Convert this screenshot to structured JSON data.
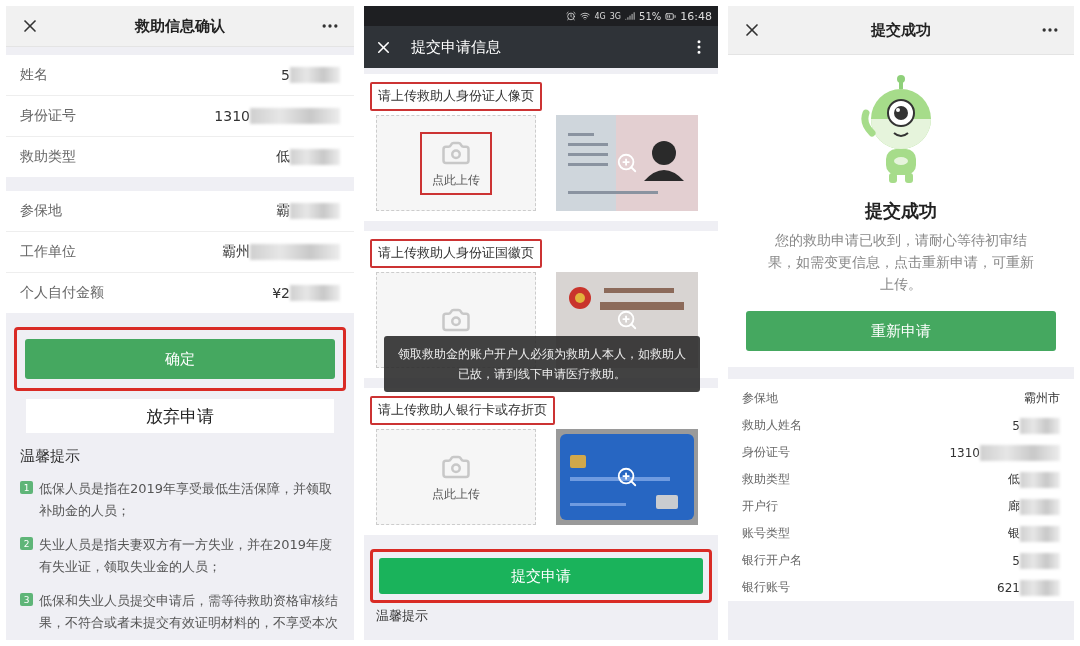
{
  "confirm_screen": {
    "title": "救助信息确认",
    "groups": [
      [
        {
          "label": "姓名",
          "value": "5",
          "redacted": true
        },
        {
          "label": "身份证号",
          "value": "1310",
          "redacted": true
        },
        {
          "label": "救助类型",
          "value": "低",
          "redacted": true
        }
      ],
      [
        {
          "label": "参保地",
          "value": "霸",
          "redacted": true
        },
        {
          "label": "工作单位",
          "value": "霸州",
          "redacted": true
        },
        {
          "label": "个人自付金额",
          "value": "¥2",
          "redacted": true
        }
      ]
    ],
    "confirm_button": {
      "label": "确定",
      "highlighted": true
    },
    "cancel_button": {
      "label": "放弃申请"
    },
    "tips_title": "温馨提示",
    "tips": [
      {
        "number": "1",
        "text": "低保人员是指在2019年享受最低生活保障，并领取补助金的人员；"
      },
      {
        "number": "2",
        "text": "失业人员是指夫妻双方有一方失业，并在2019年度有失业证，领取失业金的人员；"
      },
      {
        "number": "3",
        "text": "低保和失业人员提交申请后，需等待救助资格审核结果，不符合或者未提交有效证明材料的，不享受本次"
      }
    ]
  },
  "upload_screen": {
    "status_bar": {
      "network_1": "4G",
      "network_2": "3G",
      "battery": "51%",
      "time": "16:48"
    },
    "title": "提交申请信息",
    "sections": [
      {
        "label": "请上传救助人身份证人像页",
        "label_highlighted": true,
        "upload_text": "点此上传",
        "upload_highlighted": true,
        "kind": "id_portrait"
      },
      {
        "label": "请上传救助人身份证国徽页",
        "label_highlighted": true,
        "kind": "id_emblem"
      },
      {
        "label": "请上传救助人银行卡或存折页",
        "label_highlighted": true,
        "upload_text": "点此上传",
        "upload_highlighted": false,
        "kind": "bank_card"
      }
    ],
    "toast": "领取救助金的账户开户人必须为救助人本人，如救助人已故，请到线下申请医疗救助。",
    "submit_button": {
      "label": "提交申请",
      "highlighted": true
    },
    "tips_title": "温馨提示"
  },
  "success_screen": {
    "title": "提交成功",
    "heading": "提交成功",
    "message": "您的救助申请已收到，请耐心等待初审结果，如需变更信息，点击重新申请，可重新上传。",
    "reapply_button": "重新申请",
    "details": [
      {
        "label": "参保地",
        "value": "霸州市",
        "redacted": false
      },
      {
        "label": "救助人姓名",
        "value": "5",
        "redacted": true
      },
      {
        "label": "身份证号",
        "value": "1310",
        "redacted": true
      },
      {
        "label": "救助类型",
        "value": "低",
        "redacted": true
      },
      {
        "label": "开户行",
        "value": "廊",
        "redacted": true
      },
      {
        "label": "账号类型",
        "value": "银",
        "redacted": true
      },
      {
        "label": "银行开户名",
        "value": "5",
        "redacted": true
      },
      {
        "label": "银行账号",
        "value": "621",
        "redacted": true
      }
    ]
  }
}
